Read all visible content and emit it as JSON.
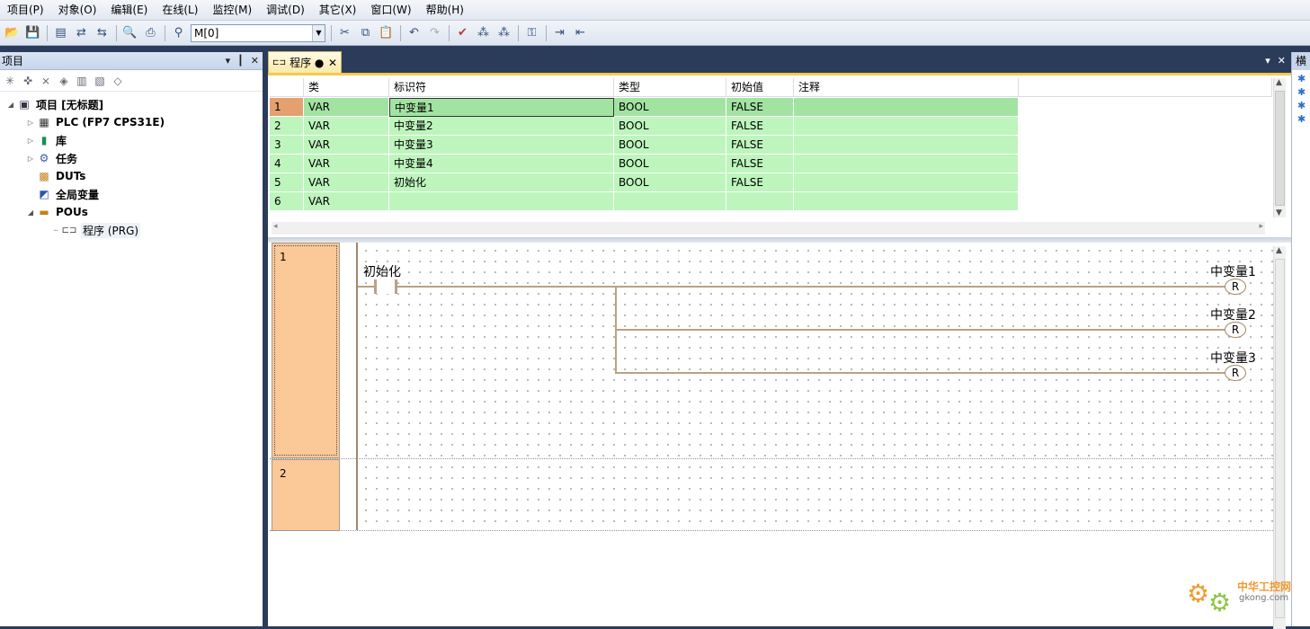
{
  "menu": [
    "项目(P)",
    "对象(O)",
    "编辑(E)",
    "在线(L)",
    "监控(M)",
    "调试(D)",
    "其它(X)",
    "窗口(W)",
    "帮助(H)"
  ],
  "toolbar": {
    "combo_value": "M[0]"
  },
  "project_panel": {
    "title": "项目",
    "tree": [
      {
        "label": "项目 [无标题]",
        "icon": "project-icon"
      },
      {
        "label": "PLC (FP7 CPS31E)",
        "icon": "plc-icon"
      },
      {
        "label": "库",
        "icon": "library-icon"
      },
      {
        "label": "任务",
        "icon": "task-icon"
      },
      {
        "label": "DUTs",
        "icon": "dut-icon"
      },
      {
        "label": "全局变量",
        "icon": "global-var-icon"
      },
      {
        "label": "POUs",
        "icon": "pou-folder-icon"
      },
      {
        "label": "程序 (PRG)",
        "icon": "program-icon"
      }
    ]
  },
  "doc_tab": {
    "label": "程序 ●"
  },
  "var_table": {
    "headers": [
      "",
      "类",
      "标识符",
      "类型",
      "初始值",
      "注释"
    ],
    "rows": [
      [
        "1",
        "VAR",
        "中变量1",
        "BOOL",
        "FALSE",
        ""
      ],
      [
        "2",
        "VAR",
        "中变量2",
        "BOOL",
        "FALSE",
        ""
      ],
      [
        "3",
        "VAR",
        "中变量3",
        "BOOL",
        "FALSE",
        ""
      ],
      [
        "4",
        "VAR",
        "中变量4",
        "BOOL",
        "FALSE",
        ""
      ],
      [
        "5",
        "VAR",
        "初始化",
        "BOOL",
        "FALSE",
        ""
      ],
      [
        "6",
        "VAR",
        "",
        "",
        "",
        ""
      ]
    ]
  },
  "ladder": {
    "networks": [
      "1",
      "2"
    ],
    "contact_label": "初始化",
    "coils": [
      {
        "name": "中变量1",
        "type": "R"
      },
      {
        "name": "中变量2",
        "type": "R"
      },
      {
        "name": "中变量3",
        "type": "R"
      }
    ]
  },
  "right_panel": {
    "title": "横"
  },
  "watermark": {
    "text": "中华工控网",
    "url": "gkong.com"
  }
}
